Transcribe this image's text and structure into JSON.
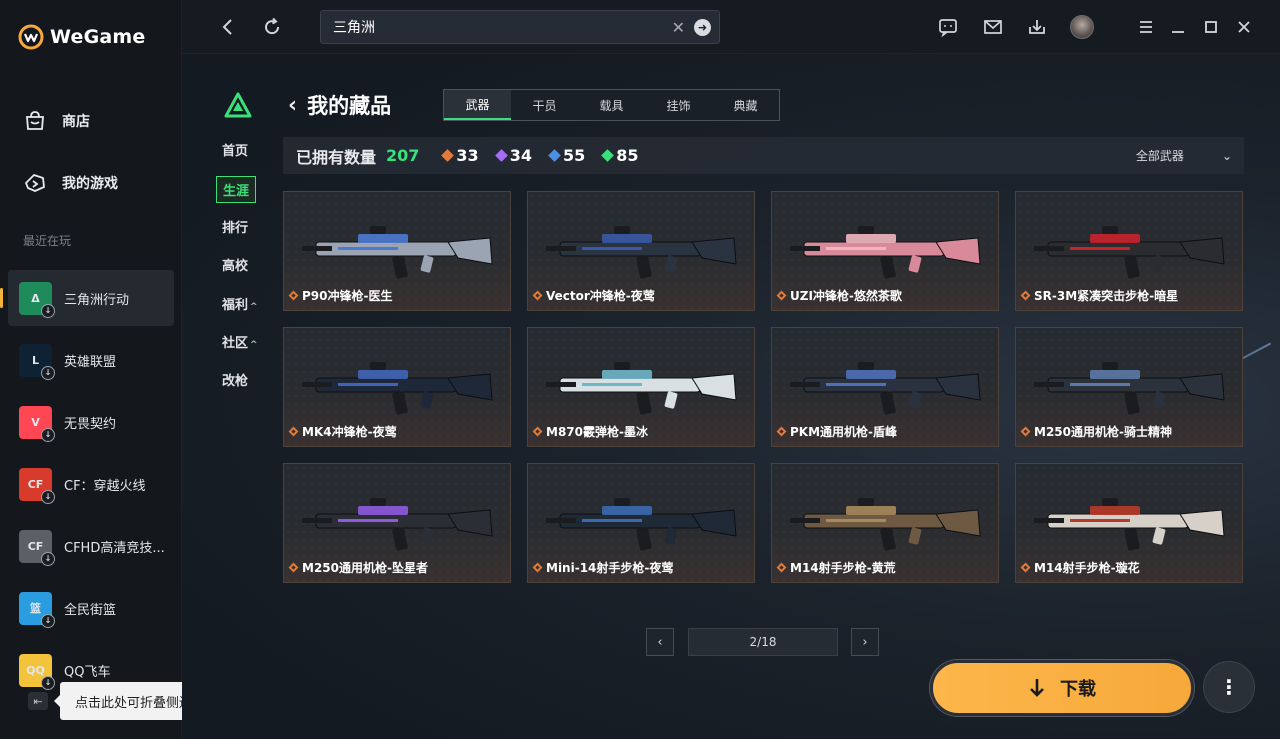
{
  "app": {
    "name": "WeGame"
  },
  "sidebar": {
    "nav": [
      {
        "label": "商店",
        "icon": "store-icon"
      },
      {
        "label": "我的游戏",
        "icon": "my-games-icon"
      }
    ],
    "recent_title": "最近在玩",
    "games": [
      {
        "label": "三角洲行动",
        "icon_text": "Δ",
        "color": "#1f8a5a",
        "active": true
      },
      {
        "label": "英雄联盟",
        "icon_text": "L",
        "color": "#0f2233",
        "active": false
      },
      {
        "label": "无畏契约",
        "icon_text": "V",
        "color": "#ff4655",
        "active": false
      },
      {
        "label": "CF：穿越火线",
        "icon_text": "CF",
        "color": "#d83b2b",
        "active": false
      },
      {
        "label": "CFHD高清竞技...",
        "icon_text": "CF",
        "color": "#5c6066",
        "active": false
      },
      {
        "label": "全民街篮",
        "icon_text": "篮",
        "color": "#2a9de0",
        "active": false
      },
      {
        "label": "QQ飞车",
        "icon_text": "QQ",
        "color": "#f3c43b",
        "active": false
      }
    ],
    "collapse_tooltip": "点击此处可折叠侧边栏"
  },
  "topbar": {
    "search_value": "三角洲",
    "icons": [
      "back-icon",
      "refresh-icon",
      "chat-icon",
      "mail-icon",
      "download-manager-icon",
      "avatar",
      "menu-icon",
      "minimize-icon",
      "maximize-icon",
      "close-icon"
    ]
  },
  "subnav": {
    "items": [
      {
        "label": "首页",
        "active": false,
        "caret": ""
      },
      {
        "label": "生涯",
        "active": true,
        "caret": ""
      },
      {
        "label": "排行",
        "active": false,
        "caret": ""
      },
      {
        "label": "高校",
        "active": false,
        "caret": ""
      },
      {
        "label": "福利",
        "active": false,
        "caret": "^"
      },
      {
        "label": "社区",
        "active": false,
        "caret": "^"
      },
      {
        "label": "改枪",
        "active": false,
        "caret": ""
      }
    ]
  },
  "collection": {
    "title": "我的藏品",
    "tabs": [
      {
        "label": "武器",
        "active": true
      },
      {
        "label": "干员",
        "active": false
      },
      {
        "label": "载具",
        "active": false
      },
      {
        "label": "挂饰",
        "active": false
      },
      {
        "label": "典藏",
        "active": false
      }
    ],
    "owned_label": "已拥有数量",
    "owned_total": "207",
    "rarity_counts": [
      {
        "value": "33",
        "color": "#e27a3a"
      },
      {
        "value": "34",
        "color": "#a36cf2"
      },
      {
        "value": "55",
        "color": "#4a8fe6"
      },
      {
        "value": "85",
        "color": "#3ae07a"
      }
    ],
    "filter_label": "全部武器",
    "items": [
      {
        "name": "P90冲锋枪-医生",
        "tint": "#9aa4b2",
        "accent": "#4d7ad0"
      },
      {
        "name": "Vector冲锋枪-夜莺",
        "tint": "#2a3340",
        "accent": "#3a5aa8"
      },
      {
        "name": "UZI冲锋枪-悠然茶歌",
        "tint": "#d98a9a",
        "accent": "#f0b6c0"
      },
      {
        "name": "SR-3M紧凑突击步枪-暗星",
        "tint": "#2a2c30",
        "accent": "#c8222c"
      },
      {
        "name": "MK4冲锋枪-夜莺",
        "tint": "#1f2838",
        "accent": "#4065b8"
      },
      {
        "name": "M870霰弹枪-墨冰",
        "tint": "#d8e0e4",
        "accent": "#6fb6c8"
      },
      {
        "name": "PKM通用机枪-盾峰",
        "tint": "#2a3240",
        "accent": "#4f6fb8"
      },
      {
        "name": "M250通用机枪-骑士精神",
        "tint": "#2b323c",
        "accent": "#5c7aa6"
      },
      {
        "name": "M250通用机枪-坠星者",
        "tint": "#2c2e36",
        "accent": "#8f5ae0"
      },
      {
        "name": "Mini-14射手步枪-夜莺",
        "tint": "#1f2a36",
        "accent": "#3a6ab0"
      },
      {
        "name": "M14射手步枪-黄荒",
        "tint": "#6e5a42",
        "accent": "#a88a5c"
      },
      {
        "name": "M14射手步枪-璇花",
        "tint": "#d6d0c8",
        "accent": "#b83a2a"
      }
    ]
  },
  "pagination": {
    "label": "2/18"
  },
  "download_label": "下载"
}
